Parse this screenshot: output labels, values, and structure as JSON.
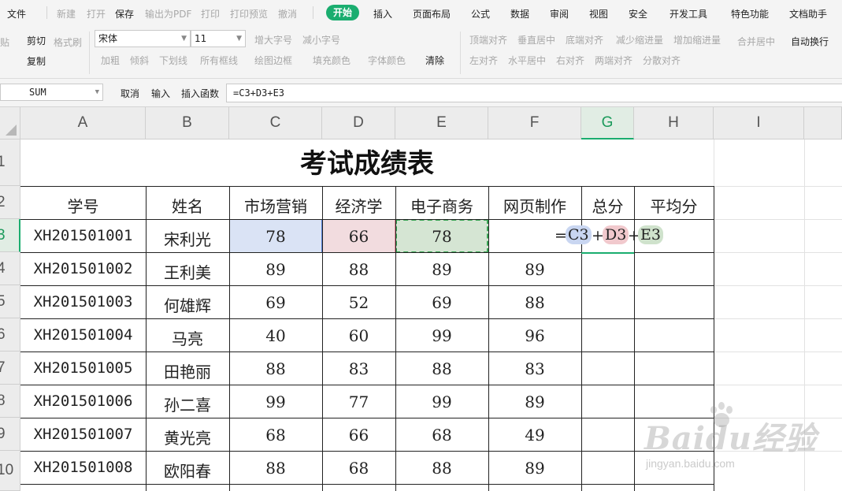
{
  "menubar": {
    "file": "文件",
    "quick": [
      "新建",
      "打开",
      "保存",
      "输出为PDF",
      "打印",
      "打印预览",
      "撤消"
    ],
    "tabs": [
      "开始",
      "插入",
      "页面布局",
      "公式",
      "数据",
      "审阅",
      "视图",
      "安全",
      "开发工具",
      "特色功能",
      "文档助手"
    ],
    "active_tab": "开始"
  },
  "ribbon": {
    "paste_partial": "贴",
    "cut": "剪切",
    "format_painter": "格式刷",
    "copy": "复制",
    "font_name": "宋体",
    "font_size": "11",
    "grow_font": "增大字号",
    "shrink_font": "减小字号",
    "bold": "加粗",
    "italic": "倾斜",
    "underline": "下划线",
    "borders": "所有框线",
    "draw_border": "绘图边框",
    "fill_color": "填充颜色",
    "font_color": "字体颜色",
    "clear": "清除",
    "align_top": "顶端对齐",
    "align_middle": "垂直居中",
    "align_bottom": "底端对齐",
    "decrease_indent": "减少缩进量",
    "increase_indent": "增加缩进量",
    "merge_center": "合并居中",
    "wrap_text": "自动换行",
    "align_left": "左对齐",
    "align_center": "水平居中",
    "align_right": "右对齐",
    "justify": "两端对齐",
    "distribute": "分散对齐"
  },
  "formula_bar": {
    "name_box": "SUM",
    "cancel": "取消",
    "enter": "输入",
    "insert_function": "插入函数",
    "formula": "=C3+D3+E3"
  },
  "sheet": {
    "columns": [
      "A",
      "B",
      "C",
      "D",
      "E",
      "F",
      "G",
      "H",
      "I"
    ],
    "selected_column": "G",
    "row_numbers": [
      "1",
      "2",
      "3",
      "4",
      "5",
      "6",
      "7",
      "8",
      "9",
      "10"
    ],
    "selected_row": "3",
    "title": "考试成绩表",
    "headers": [
      "学号",
      "姓名",
      "市场营销",
      "经济学",
      "电子商务",
      "网页制作",
      "总分",
      "平均分"
    ],
    "rows": [
      {
        "id": "XH201501001",
        "name": "宋利光",
        "c": "78",
        "d": "66",
        "e": "78",
        "f": ""
      },
      {
        "id": "XH201501002",
        "name": "王利美",
        "c": "89",
        "d": "88",
        "e": "89",
        "f": "89"
      },
      {
        "id": "XH201501003",
        "name": "何雄辉",
        "c": "69",
        "d": "52",
        "e": "69",
        "f": "88"
      },
      {
        "id": "XH201501004",
        "name": "马亮",
        "c": "40",
        "d": "60",
        "e": "99",
        "f": "96"
      },
      {
        "id": "XH201501005",
        "name": "田艳丽",
        "c": "88",
        "d": "83",
        "e": "88",
        "f": "83"
      },
      {
        "id": "XH201501006",
        "name": "孙二喜",
        "c": "99",
        "d": "77",
        "e": "99",
        "f": "89"
      },
      {
        "id": "XH201501007",
        "name": "黄光亮",
        "c": "68",
        "d": "66",
        "e": "68",
        "f": "49"
      },
      {
        "id": "XH201501008",
        "name": "欧阳春",
        "c": "88",
        "d": "68",
        "e": "88",
        "f": "89"
      }
    ],
    "inline_formula": {
      "eq": "=",
      "c": "C3",
      "plus1": "+",
      "d": "D3",
      "plus2": "+",
      "e": "E3"
    }
  },
  "watermark": {
    "logo": "Baidu经验",
    "url": "jingyan.baidu.com"
  },
  "colors": {
    "accent": "#1aad6f",
    "ref_c": "#dae3f5",
    "ref_d": "#f2dcdf",
    "ref_e": "#d5e5d3"
  }
}
